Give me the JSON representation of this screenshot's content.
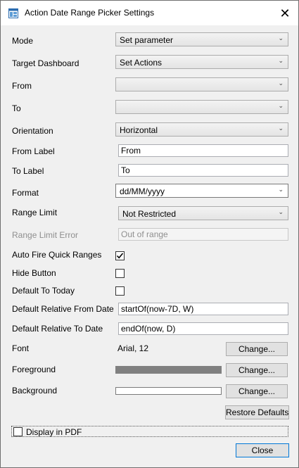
{
  "window": {
    "title": "Action Date Range Picker Settings",
    "close_glyph": "✕"
  },
  "fields": {
    "mode": {
      "label": "Mode",
      "value": "Set parameter"
    },
    "target_dashboard": {
      "label": "Target Dashboard",
      "value": "Set Actions"
    },
    "from": {
      "label": "From",
      "value": ""
    },
    "to": {
      "label": "To",
      "value": ""
    },
    "orientation": {
      "label": "Orientation",
      "value": "Horizontal"
    },
    "from_label": {
      "label": "From Label",
      "value": "From"
    },
    "to_label": {
      "label": "To Label",
      "value": "To"
    },
    "format": {
      "label": "Format",
      "value": "dd/MM/yyyy"
    },
    "range_limit": {
      "label": "Range Limit",
      "value": "Not Restricted"
    },
    "range_limit_error": {
      "label": "Range Limit Error",
      "value": "Out of range",
      "enabled": false
    },
    "auto_fire_quick_ranges": {
      "label": "Auto Fire Quick Ranges",
      "checked": true
    },
    "hide_button": {
      "label": "Hide Button",
      "checked": false
    },
    "default_to_today": {
      "label": "Default To Today",
      "checked": false
    },
    "default_relative_from": {
      "label": "Default Relative From Date",
      "value": "startOf(now-7D, W)"
    },
    "default_relative_to": {
      "label": "Default Relative To Date",
      "value": "endOf(now, D)"
    },
    "font": {
      "label": "Font",
      "value": "Arial, 12",
      "button": "Change..."
    },
    "foreground": {
      "label": "Foreground",
      "color": "#808080",
      "button": "Change..."
    },
    "background": {
      "label": "Background",
      "color": "#ffffff",
      "button": "Change..."
    }
  },
  "restore_defaults": "Restore Defaults",
  "display_in_pdf": {
    "label": "Display in PDF",
    "checked": false
  },
  "close_button": "Close",
  "icons": {
    "dropdown_arrow": "chevron-down-icon",
    "app": "dashboard-icon"
  }
}
